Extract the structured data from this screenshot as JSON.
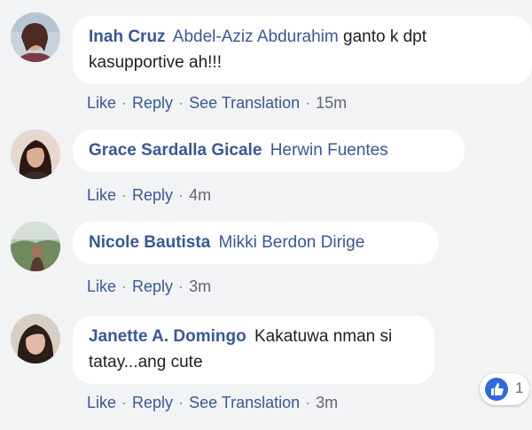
{
  "comments": [
    {
      "author": "Inah Cruz",
      "mention": "Abdel-Aziz Abdurahim",
      "text_line1": "ganto k dpt",
      "text_line2": "kasupportive ah!!!",
      "actions": {
        "like": "Like",
        "reply": "Reply",
        "translate": "See Translation",
        "time": "15m"
      }
    },
    {
      "author": "Grace Sardalla Gicale",
      "mention": "Herwin Fuentes",
      "actions": {
        "like": "Like",
        "reply": "Reply",
        "time": "4m"
      }
    },
    {
      "author": "Nicole Bautista",
      "mention": "Mikki Berdon Dirige",
      "actions": {
        "like": "Like",
        "reply": "Reply",
        "time": "3m"
      }
    },
    {
      "author": "Janette A. Domingo",
      "text_line1": "Kakatuwa nman si",
      "text_line2": "tatay...ang cute",
      "actions": {
        "like": "Like",
        "reply": "Reply",
        "translate": "See Translation",
        "time": "3m"
      },
      "reaction_count": "1"
    }
  ],
  "separator": "·",
  "colors": {
    "link": "#385898",
    "background": "#f2f3f5",
    "like_blue": "#2f69e0"
  }
}
